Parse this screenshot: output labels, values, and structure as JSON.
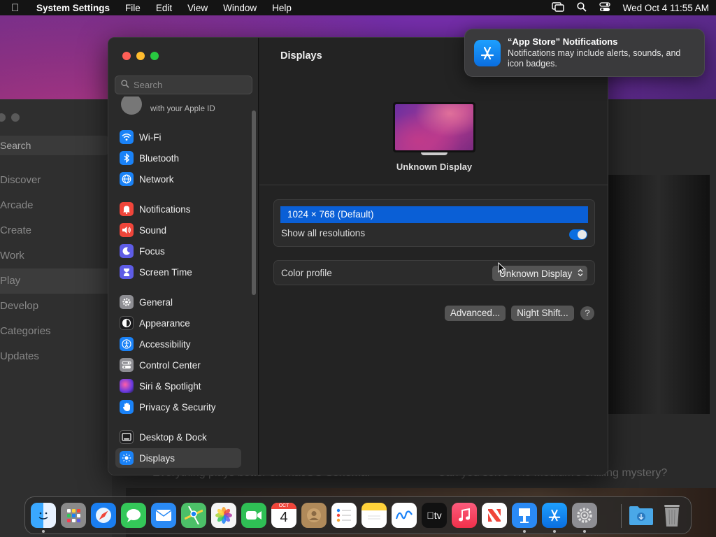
{
  "menubar": {
    "app_name": "System Settings",
    "menus": [
      "File",
      "Edit",
      "View",
      "Window",
      "Help"
    ],
    "datetime": "Wed Oct 4  11:55 AM"
  },
  "background_app": {
    "search_label": "Search",
    "items": [
      "Discover",
      "Arcade",
      "Create",
      "Work",
      "Play",
      "Develop",
      "Categories",
      "Updates"
    ],
    "bottom_left_text": "Everything plays better on macOS Sonoma.",
    "bottom_right_text": "Can you solve The Medium's chilling mystery?"
  },
  "sidebar": {
    "search_placeholder": "Search",
    "apple_id_text": "with your Apple ID",
    "items": [
      {
        "label": "Wi-Fi",
        "color": "#1a82f7",
        "icon": "wifi-icon"
      },
      {
        "label": "Bluetooth",
        "color": "#1a82f7",
        "icon": "bluetooth-icon"
      },
      {
        "label": "Network",
        "color": "#1a82f7",
        "icon": "globe-icon"
      },
      {
        "label": "Notifications",
        "color": "#f0453a",
        "icon": "bell-icon"
      },
      {
        "label": "Sound",
        "color": "#f0453a",
        "icon": "speaker-icon"
      },
      {
        "label": "Focus",
        "color": "#5e5ce6",
        "icon": "moon-icon"
      },
      {
        "label": "Screen Time",
        "color": "#5e5ce6",
        "icon": "hourglass-icon"
      },
      {
        "label": "General",
        "color": "#8e8e93",
        "icon": "gear-icon"
      },
      {
        "label": "Appearance",
        "color": "#1c1c1e",
        "icon": "appearance-icon"
      },
      {
        "label": "Accessibility",
        "color": "#1a82f7",
        "icon": "accessibility-icon"
      },
      {
        "label": "Control Center",
        "color": "#8e8e93",
        "icon": "switches-icon"
      },
      {
        "label": "Siri & Spotlight",
        "color": "#b03aa0",
        "icon": "siri-icon"
      },
      {
        "label": "Privacy & Security",
        "color": "#1a82f7",
        "icon": "hand-icon"
      },
      {
        "label": "Desktop & Dock",
        "color": "#1c1c1e",
        "icon": "dock-icon"
      },
      {
        "label": "Displays",
        "color": "#1a82f7",
        "icon": "sun-icon"
      }
    ],
    "active": "Displays"
  },
  "main": {
    "title": "Displays",
    "display_name": "Unknown Display",
    "resolution_selected": "1024 × 768 (Default)",
    "show_all_label": "Show all resolutions",
    "show_all_enabled": true,
    "color_profile_label": "Color profile",
    "color_profile_value": "Unknown Display",
    "advanced_label": "Advanced...",
    "night_shift_label": "Night Shift...",
    "help_label": "?"
  },
  "notification": {
    "title": "“App Store” Notifications",
    "body": "Notifications may include alerts, sounds, and icon badges."
  },
  "dock": {
    "calendar_month": "OCT",
    "calendar_day": "4",
    "tv_label": "tv",
    "apps": [
      {
        "name": "Finder",
        "color": "#1e8ff0"
      },
      {
        "name": "Launchpad",
        "color": "#8a8a8a"
      },
      {
        "name": "Safari",
        "color": "#1a7ef0"
      },
      {
        "name": "Messages",
        "color": "#34c759"
      },
      {
        "name": "Mail",
        "color": "#2a8af5"
      },
      {
        "name": "Maps",
        "color": "#4cc068"
      },
      {
        "name": "Photos",
        "color": "#f5f5f5"
      },
      {
        "name": "FaceTime",
        "color": "#2fbf55"
      },
      {
        "name": "Calendar",
        "color": "#ffffff"
      },
      {
        "name": "Contacts",
        "color": "#b08a5a"
      },
      {
        "name": "Reminders",
        "color": "#ffffff"
      },
      {
        "name": "Notes",
        "color": "#ffd23a"
      },
      {
        "name": "Freeform",
        "color": "#ffffff"
      },
      {
        "name": "TV",
        "color": "#111111"
      },
      {
        "name": "Music",
        "color": "#fa3c50"
      },
      {
        "name": "News",
        "color": "#ffffff"
      },
      {
        "name": "Keynote",
        "color": "#2a8af5"
      },
      {
        "name": "App Store",
        "color": "#1a82f7"
      },
      {
        "name": "System Settings",
        "color": "#8e8e93"
      },
      {
        "name": "Downloads",
        "color": "#4aa8e8"
      },
      {
        "name": "Trash",
        "color": "#9a9a9a"
      }
    ]
  }
}
